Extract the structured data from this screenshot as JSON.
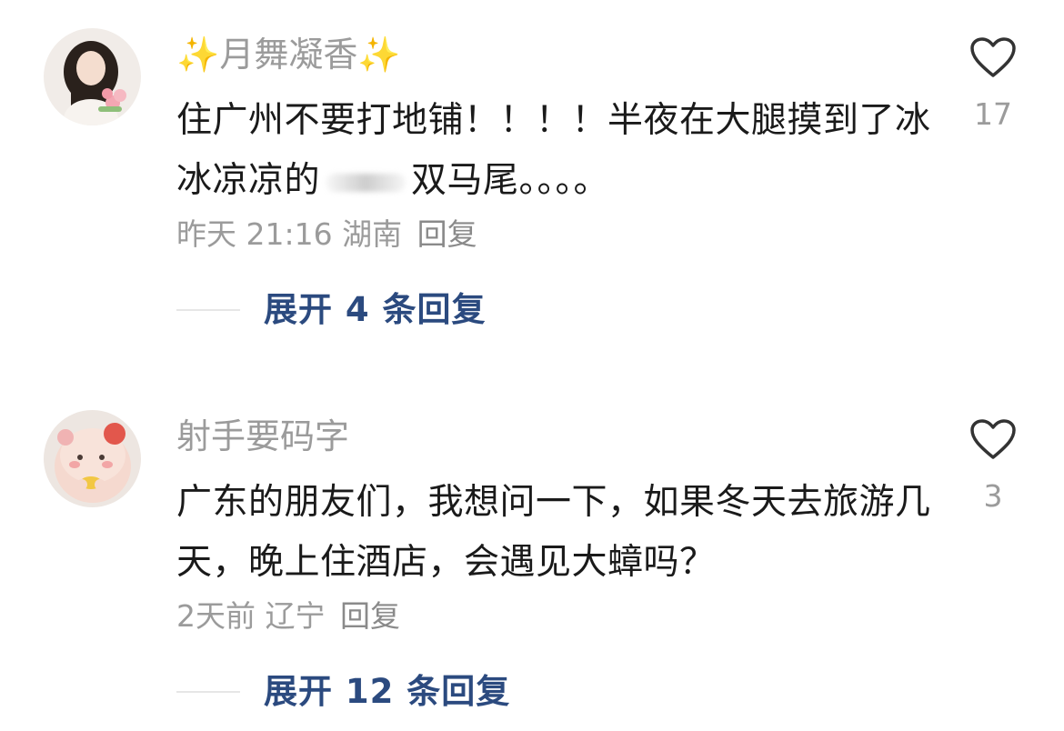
{
  "comments": [
    {
      "username": "✨月舞凝香✨",
      "text_before": "住广州不要打地铺！！！！半夜在大腿摸到了冰冰凉凉的",
      "text_after": "双马尾。。。。",
      "time": "昨天 21:16",
      "location": "湖南",
      "reply_label": "回复",
      "expand_label": "展开 4 条回复",
      "likes": "17"
    },
    {
      "username": "射手要码字",
      "text": "广东的朋友们，我想问一下，如果冬天去旅游几天，晚上住酒店，会遇见大蟑吗？",
      "time": "2天前",
      "location": "辽宁",
      "reply_label": "回复",
      "expand_label": "展开 12 条回复",
      "likes": "3"
    }
  ],
  "colors": {
    "meta_gray": "#9b9b9b",
    "text_dark": "#1a1a1a",
    "link_blue": "#2b4a7f"
  }
}
